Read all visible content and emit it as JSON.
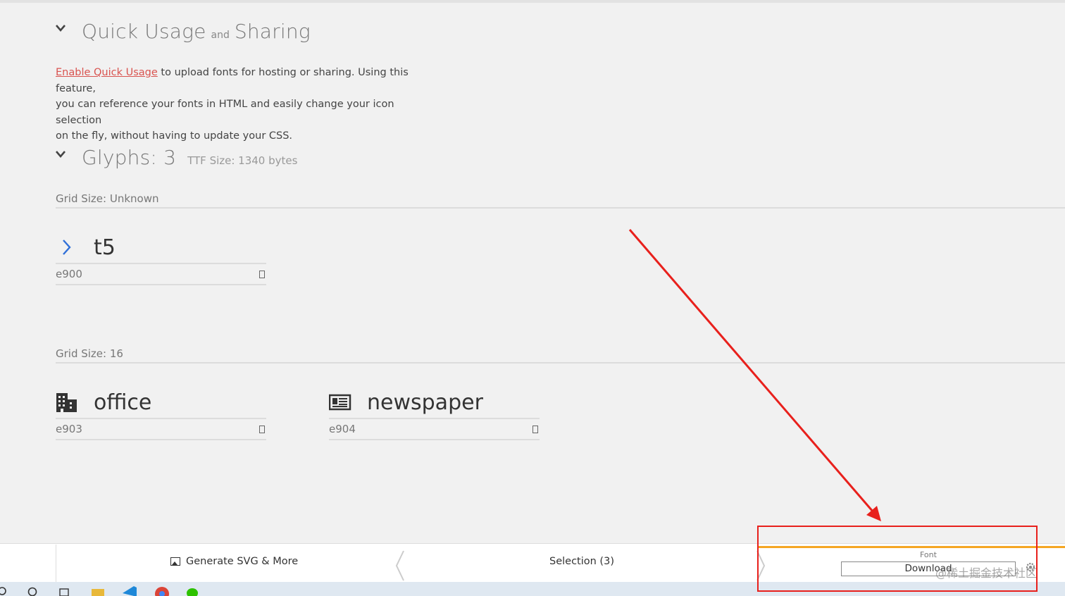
{
  "quick_usage": {
    "title_main": "Quick Usage",
    "title_and": "and",
    "title_end": "Sharing",
    "link": "Enable Quick Usage",
    "line1_rest": " to upload fonts for hosting or sharing. Using this feature,",
    "line2": "you can reference your fonts in HTML and easily change your icon selection",
    "line3": "on the fly, without having to update your CSS."
  },
  "glyphs": {
    "title": "Glyphs: 3",
    "ttf_size": "TTF Size: 1340 bytes"
  },
  "groups": [
    {
      "grid_label": "Grid Size: Unknown",
      "items": [
        {
          "name": "t5",
          "code": "e900",
          "icon": "chevron-right-icon"
        }
      ]
    },
    {
      "grid_label": "Grid Size: 16",
      "items": [
        {
          "name": "office",
          "code": "e903",
          "icon": "office-icon"
        },
        {
          "name": "newspaper",
          "code": "e904",
          "icon": "newspaper-icon"
        }
      ]
    }
  ],
  "bottom_bar": {
    "generate": "Generate SVG & More",
    "selection": "Selection (3)",
    "font_label": "Font",
    "download": "Download"
  },
  "watermark": "@稀土掘金技术社区",
  "colors": {
    "link": "#d9534f",
    "accent_orange": "#f5a623",
    "annotation_red": "#e8201c"
  }
}
